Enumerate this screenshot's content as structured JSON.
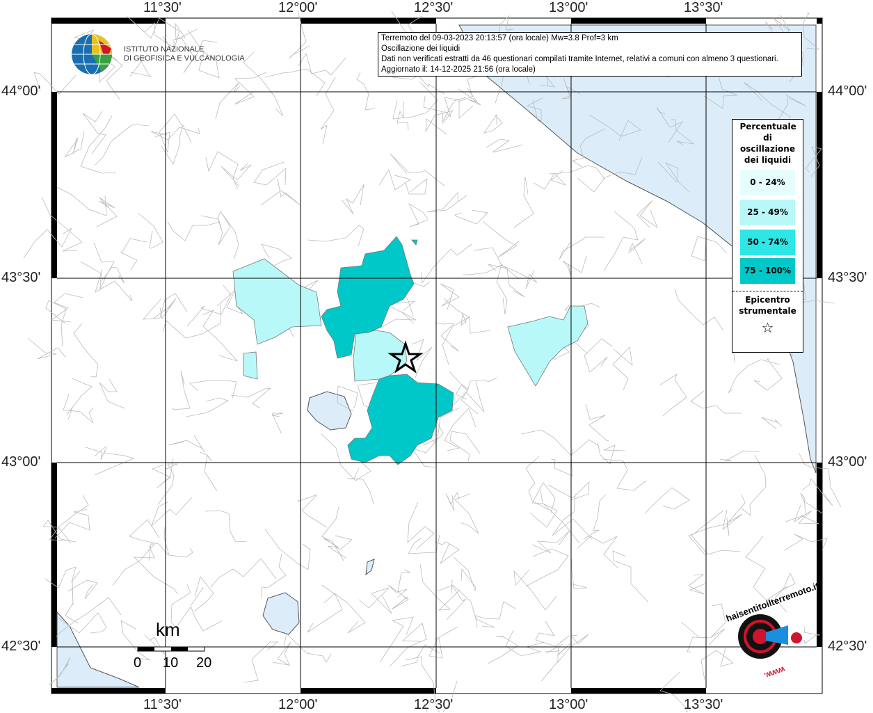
{
  "axes": {
    "lon_labels": [
      "11°30'",
      "12°00'",
      "12°30'",
      "13°00'",
      "13°30'"
    ],
    "lat_labels": [
      "44°00'",
      "43°30'",
      "43°00'",
      "42°30'"
    ]
  },
  "institute": {
    "name_line1": "ISTITUTO NAZIONALE",
    "name_line2": "DI GEOFISICA E VULCANOLOGIA"
  },
  "info": {
    "line1": "Terremoto del 09-03-2023 20:13:57 (ora locale) Mw=3.8 Prof=3 km",
    "line2": "Oscillazione dei liquidi",
    "line3": "Dati non verificati estratti da 46 questionari compilati tramite Internet, relativi a comuni con almeno 3 questionari.",
    "line4": "Aggiornato il: 14-12-2025 21:56 (ora locale)"
  },
  "legend": {
    "title": "Percentuale di oscillazione dei liquidi",
    "classes": [
      {
        "label": "0 - 24%",
        "color": "#e6fdfd"
      },
      {
        "label": "25 - 49%",
        "color": "#b8f8f8"
      },
      {
        "label": "50 - 74%",
        "color": "#2ee6e6"
      },
      {
        "label": "75 - 100%",
        "color": "#00c8c8"
      }
    ],
    "epicenter_label": "Epicentro strumentale",
    "epicenter_symbol": "☆"
  },
  "scale": {
    "unit": "km",
    "ticks": [
      "0",
      "10",
      "20"
    ]
  },
  "brand": {
    "text": "haisentitoilterremoto.it",
    "url": "www."
  },
  "colors": {
    "sea": "#dcedf9",
    "border": "#999999"
  }
}
